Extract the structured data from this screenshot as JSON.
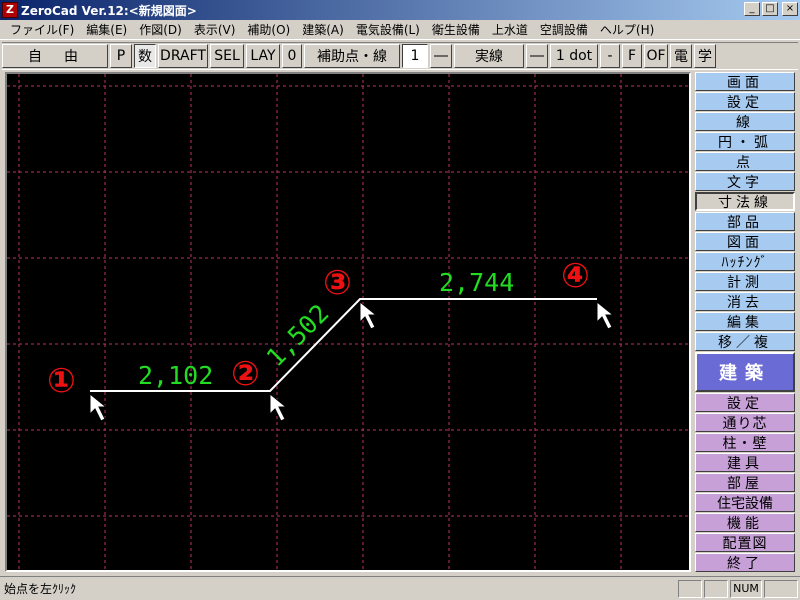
{
  "window": {
    "title": "ZeroCad Ver.12:<新規図面>",
    "minimize_glyph": "_",
    "maximize_glyph": "□",
    "close_glyph": "×",
    "app_icon_glyph": "Z"
  },
  "menu": [
    "ファイル(F)",
    "編集(E)",
    "作図(D)",
    "表示(V)",
    "補助(O)",
    "建築(A)",
    "電気設備(L)",
    "衛生設備",
    "上水道",
    "空調設備",
    "ヘルプ(H)"
  ],
  "toolbar": {
    "mode": "自　由",
    "p": "P",
    "num": "数",
    "draft": "DRAFT",
    "sel": "SEL",
    "lay": "LAY",
    "layer": "0",
    "aux": "補助点・線",
    "line_no": "1",
    "line_glyph": "―",
    "line_type": "実線",
    "dot_glyph": "―",
    "dot": "1 dot",
    "minus": "-",
    "f": "F",
    "of": "OF",
    "den": "電",
    "gaku": "学"
  },
  "sidebar": {
    "blue": [
      "画面",
      "設定",
      "線",
      "円・弧",
      "点",
      "文字",
      "寸法線",
      "部品",
      "図面",
      "ﾊｯﾁﾝｸﾞ",
      "計測",
      "消去",
      "編集",
      "移／複"
    ],
    "active": "寸法線",
    "section": "建築",
    "purple": [
      "設定",
      "通り芯",
      "柱・壁",
      "建具",
      "部屋",
      "住宅設備",
      "機能",
      "配置図",
      "終了"
    ]
  },
  "drawing": {
    "point_labels": [
      "①",
      "②",
      "③",
      "④"
    ],
    "dims": [
      "2,102",
      "1,502",
      "2,744"
    ],
    "colors": {
      "grid": "#c0306a",
      "line": "#ffffff",
      "dim": "#22dd22",
      "marker": "#ee1111"
    }
  },
  "status": {
    "text": "始点を左ｸﾘｯｸ",
    "panels": [
      "",
      "",
      "NUM",
      ""
    ]
  }
}
